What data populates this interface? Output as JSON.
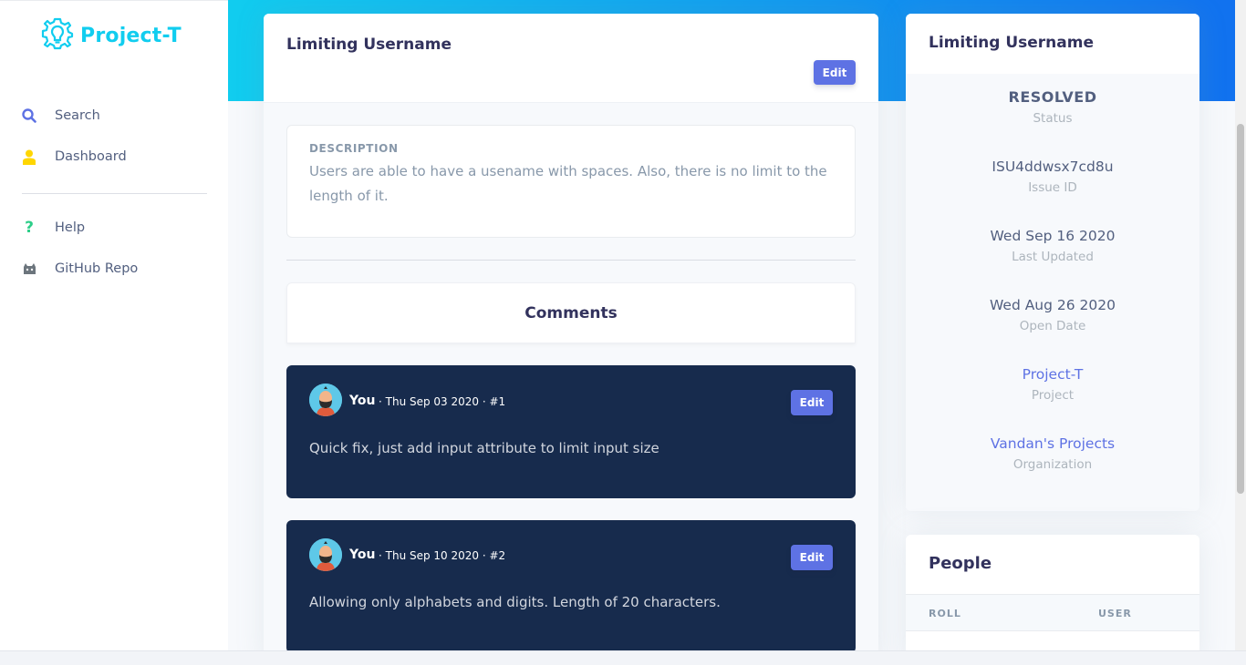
{
  "brand": {
    "name": "Project-T"
  },
  "sidebar": {
    "items": [
      {
        "label": "Search",
        "icon": "search-icon"
      },
      {
        "label": "Dashboard",
        "icon": "user-icon"
      },
      {
        "label": "Help",
        "icon": "question-icon"
      },
      {
        "label": "GitHub Repo",
        "icon": "github-icon"
      }
    ]
  },
  "issue": {
    "title": "Limiting Username",
    "edit_label": "Edit",
    "description_label": "Description",
    "description": "Users are able to have a usename with spaces. Also, there is no limit to the length of it."
  },
  "comments": {
    "heading": "Comments",
    "items": [
      {
        "author": "You",
        "meta": "· Thu Sep 03 2020 · #1",
        "text": "Quick fix, just add input attribute to limit input size",
        "edit_label": "Edit"
      },
      {
        "author": "You",
        "meta": "· Thu Sep 10 2020 · #2",
        "text": "Allowing only alphabets and digits. Length of 20 characters.",
        "edit_label": "Edit"
      }
    ]
  },
  "details": {
    "title": "Limiting Username",
    "stats": [
      {
        "value": "RESOLVED",
        "label": "Status"
      },
      {
        "value": "ISU4ddwsx7cd8u",
        "label": "Issue ID"
      },
      {
        "value": "Wed Sep 16 2020",
        "label": "Last Updated"
      },
      {
        "value": "Wed Aug 26 2020",
        "label": "Open Date"
      },
      {
        "value": "Project-T",
        "label": "Project"
      },
      {
        "value": "Vandan's Projects",
        "label": "Organization"
      }
    ]
  },
  "people": {
    "title": "People",
    "columns": [
      "ROLL",
      "USER"
    ]
  },
  "colors": {
    "brand": "#11cdef",
    "primary": "#5e72e4",
    "comment_bg": "#172b4d",
    "hero_start": "#11cdef",
    "hero_end": "#1171ef"
  }
}
